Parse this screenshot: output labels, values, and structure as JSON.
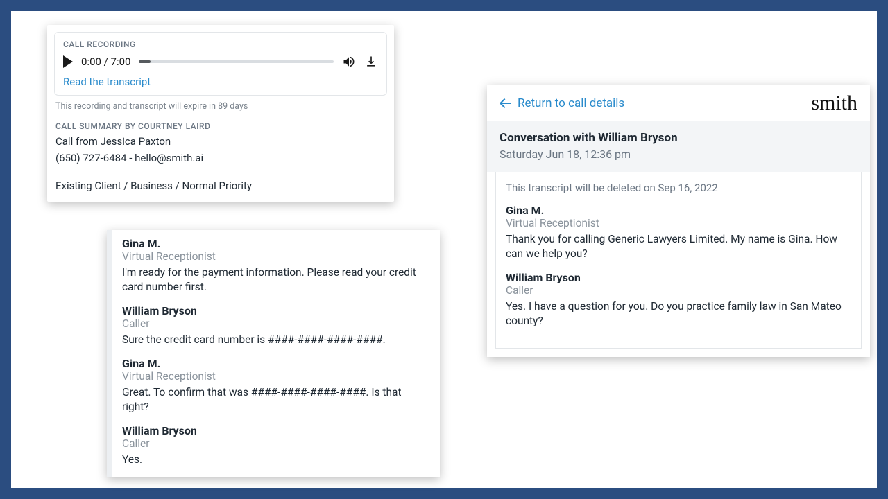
{
  "recording": {
    "label": "CALL RECORDING",
    "current_time": "0:00",
    "total_time": "7:00",
    "time_display": "0:00 / 7:00",
    "read_link": "Read the transcript",
    "expiry": "This recording and transcript will expire in 89 days"
  },
  "summary": {
    "label": "CALL SUMMARY BY COURTNEY LAIRD",
    "from": "Call from Jessica Paxton",
    "contact": "(650) 727-6484 - hello@smith.ai",
    "tags": "Existing Client / Business / Normal Priority"
  },
  "snippet": {
    "messages": [
      {
        "name": "Gina M.",
        "role": "Virtual Receptionist",
        "text": "I'm ready for the payment information. Please read your credit card number first."
      },
      {
        "name": "William Bryson",
        "role": "Caller",
        "text": "Sure the credit card number is ####-####-####-####."
      },
      {
        "name": "Gina M.",
        "role": "Virtual Receptionist",
        "text": "Great. To confirm that was ####-####-####-####. Is that right?"
      },
      {
        "name": "William Bryson",
        "role": "Caller",
        "text": "Yes."
      }
    ]
  },
  "panel": {
    "back": "Return to call details",
    "brand": "smith",
    "title": "Conversation with William Bryson",
    "date": "Saturday Jun 18, 12:36 pm",
    "expiry": "This transcript will be deleted on Sep 16, 2022",
    "messages": [
      {
        "name": "Gina M.",
        "role": "Virtual Receptionist",
        "text": "Thank you for calling Generic Lawyers Limited. My name is Gina. How can we help you?"
      },
      {
        "name": "William Bryson",
        "role": "Caller",
        "text": "Yes. I have a question for you. Do you practice family law in San Mateo county?"
      }
    ]
  }
}
